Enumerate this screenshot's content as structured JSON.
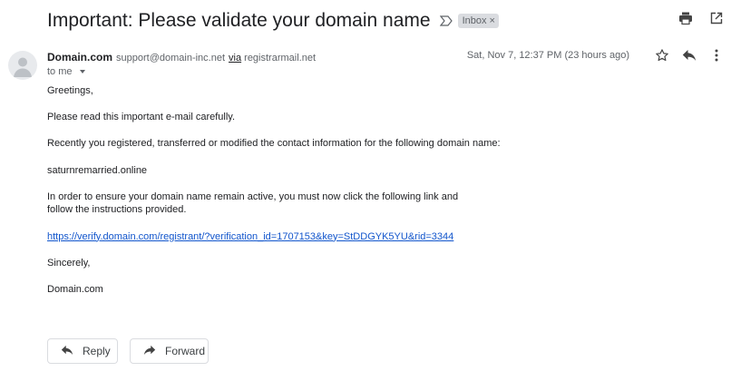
{
  "email": {
    "subject": "Important: Please validate your domain name",
    "label": "Inbox",
    "label_close": "×",
    "sender_name": "Domain.com",
    "sender_email": "support@domain-inc.net",
    "via_word": "via",
    "via_domain": "registrarmail.net",
    "recipient": "to me",
    "date": "Sat, Nov 7, 12:37 PM (23 hours ago)",
    "body": {
      "greeting": "Greetings,",
      "p1": "Please read this important e-mail carefully.",
      "p2": "Recently you registered, transferred or modified the contact information for the following domain name:",
      "domain": "saturnremarried.online",
      "p3_line1": "In order to ensure your domain name remain active, you must now click the following link and",
      "p3_line2": "follow the instructions provided.",
      "link": "https://verify.domain.com/registrant/?verification_id=1707153&key=StDDGYK5YU&rid=3344",
      "closing": "Sincerely,",
      "signature": "Domain.com"
    }
  },
  "actions": {
    "reply_label": "Reply",
    "forward_label": "Forward"
  },
  "icons": {
    "importance": "importance-marker-icon",
    "print": "print-icon",
    "open_new_window": "open-in-new-window-icon",
    "star": "star-icon",
    "reply": "reply-icon",
    "more": "more-vert-icon",
    "forward": "forward-icon"
  },
  "colors": {
    "text": "#202124",
    "muted": "#5f6368",
    "link": "#1155cc",
    "chip": "#dadce0"
  }
}
